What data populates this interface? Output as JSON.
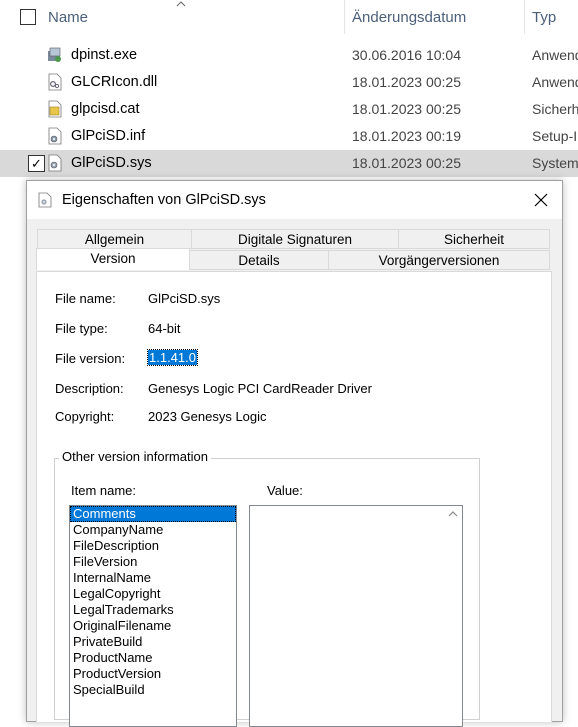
{
  "explorer": {
    "columns": {
      "name": "Name",
      "date": "Änderungsdatum",
      "type": "Typ"
    },
    "files": [
      {
        "name": "dpinst.exe",
        "date": "30.06.2016 10:04",
        "type": "Anwend",
        "icon": "exe-icon",
        "selected": false
      },
      {
        "name": "GLCRIcon.dll",
        "date": "18.01.2023 00:25",
        "type": "Anwend",
        "icon": "dll-icon",
        "selected": false
      },
      {
        "name": "glpcisd.cat",
        "date": "18.01.2023 00:25",
        "type": "Sicherh",
        "icon": "cat-icon",
        "selected": false
      },
      {
        "name": "GlPciSD.inf",
        "date": "18.01.2023 00:19",
        "type": "Setup-I",
        "icon": "inf-icon",
        "selected": false
      },
      {
        "name": "GlPciSD.sys",
        "date": "18.01.2023 00:25",
        "type": "System",
        "icon": "sys-icon",
        "selected": true
      }
    ]
  },
  "dialog": {
    "title": "Eigenschaften von GlPciSD.sys",
    "tabs_row1": [
      "Allgemein",
      "Digitale Signaturen",
      "Sicherheit"
    ],
    "tabs_row2": [
      "Version",
      "Details",
      "Vorgängerversionen"
    ],
    "active_tab": "Version",
    "fields": [
      {
        "label": "File name:",
        "value": "GlPciSD.sys"
      },
      {
        "label": "File type:",
        "value": "64-bit"
      },
      {
        "label": "File version:",
        "value": "1.1.41.0"
      },
      {
        "label": "Description:",
        "value": "Genesys Logic PCI CardReader Driver"
      },
      {
        "label": "Copyright:",
        "value": "2023 Genesys Logic"
      }
    ],
    "group_title": "Other version information",
    "item_name_label": "Item name:",
    "value_label": "Value:",
    "items": [
      "Comments",
      "CompanyName",
      "FileDescription",
      "FileVersion",
      "InternalName",
      "LegalCopyright",
      "LegalTrademarks",
      "OriginalFilename",
      "PrivateBuild",
      "ProductName",
      "ProductVersion",
      "SpecialBuild"
    ],
    "selected_item": "Comments",
    "accent_color": "#0078d7"
  }
}
